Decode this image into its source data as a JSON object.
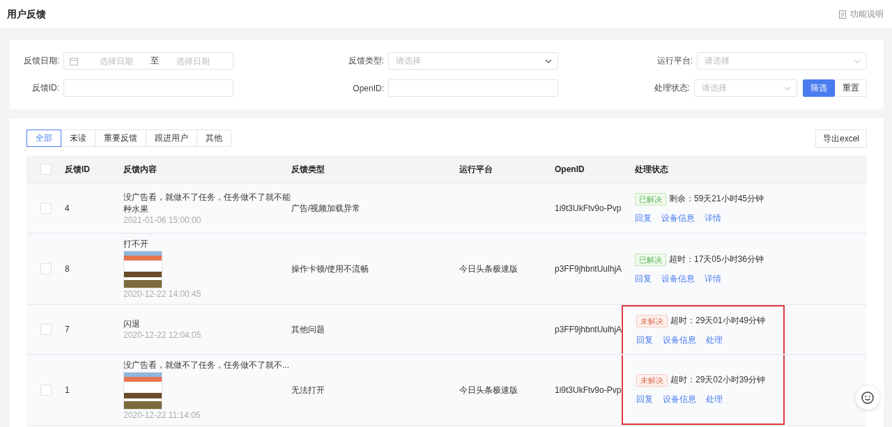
{
  "page_title": "用户反馈",
  "help_link": "功能说明",
  "filters": {
    "date": {
      "label": "反馈日期:",
      "start_placeholder": "选择日期",
      "separator": "至",
      "end_placeholder": "选择日期"
    },
    "feedback_type": {
      "label": "反馈类型:",
      "placeholder": "请选择"
    },
    "platform": {
      "label": "运行平台:",
      "placeholder": "请选择"
    },
    "feedback_id": {
      "label": "反馈ID:"
    },
    "openid": {
      "label": "OpenID:"
    },
    "status": {
      "label": "处理状态:",
      "placeholder": "请选择"
    },
    "buttons": [
      {
        "label": "筛选",
        "kind": "primary"
      },
      {
        "label": "重置",
        "kind": "default"
      }
    ]
  },
  "tabs": [
    {
      "label": "全部",
      "selected": true
    },
    {
      "label": "未读",
      "selected": false
    },
    {
      "label": "重要反馈",
      "selected": false
    },
    {
      "label": "跟进用户",
      "selected": false
    },
    {
      "label": "其他",
      "selected": false
    }
  ],
  "export_button": "导出excel",
  "table": {
    "columns": [
      "反馈ID",
      "反馈内容",
      "反馈类型",
      "运行平台",
      "OpenID",
      "处理状态"
    ],
    "select_all_checked": false,
    "rows": [
      {
        "id": "4",
        "content": "没广告看，就做不了任务，任务做不了就不能种水果",
        "screenshot": false,
        "time": "2021-01-06 15:00:00",
        "type": "广告/视频加载异常",
        "openid": "1i9t3UkFtv9o-Pvp",
        "status": {
          "label": "已解决",
          "resolved": true
        },
        "countdown": "剩余：59天21小时45分钟",
        "actions": [
          "回复",
          "设备信息",
          "详情"
        ],
        "selected": false,
        "highlighted": false
      },
      {
        "id": "8",
        "content": "打不开",
        "screenshot": true,
        "time": "2020-12-22 14:00:45",
        "type": "操作卡顿/使用不流畅",
        "platform": "今日头条极速版",
        "openid": "p3FF9jhbntUulhjA",
        "status": {
          "label": "已解决",
          "resolved": true
        },
        "countdown": "超时：17天05小时36分钟",
        "actions": [
          "回复",
          "设备信息",
          "详情"
        ],
        "selected": false,
        "highlighted": false
      },
      {
        "id": "7",
        "content": "闪退",
        "screenshot": false,
        "time": "2020-12-22 12:04:05",
        "type": "其他问题",
        "openid": "p3FF9jhbntUulhjA",
        "status": {
          "label": "未解决",
          "resolved": false
        },
        "countdown": "超时：29天01小时49分钟",
        "actions": [
          "回复",
          "设备信息",
          "处理"
        ],
        "selected": false,
        "highlighted": true
      },
      {
        "id": "1",
        "content": "没广告看，就做不了任务，任务做不了就不...",
        "screenshot": true,
        "time": "2020-12-22 11:14:05",
        "type": "无法打开",
        "platform": "今日头条极速版",
        "openid": "1i9t3UkFtv9o-Pvp",
        "status": {
          "label": "未解决",
          "resolved": false
        },
        "countdown": "超时：29天02小时39分钟",
        "actions": [
          "回复",
          "设备信息",
          "处理"
        ],
        "selected": false,
        "highlighted": true
      }
    ]
  }
}
